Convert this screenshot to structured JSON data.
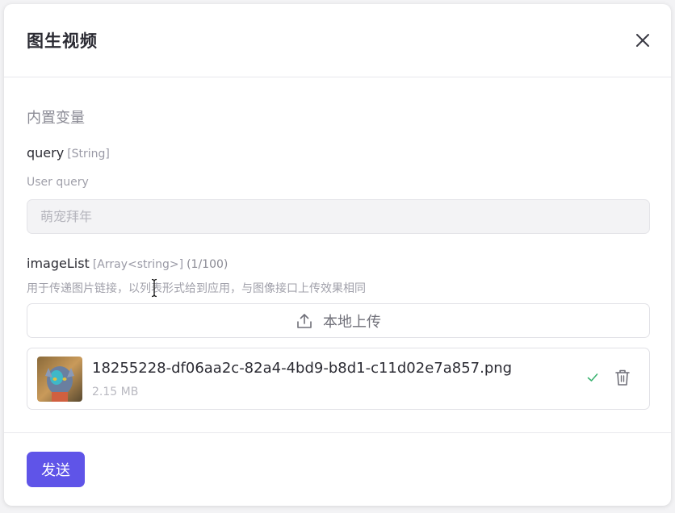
{
  "modal": {
    "title": "图生视频",
    "close_icon": "close-icon"
  },
  "section": {
    "label": "内置变量"
  },
  "query_var": {
    "name": "query",
    "type": "[String]",
    "description": "User query",
    "value": "萌宠拜年"
  },
  "image_list_var": {
    "name": "imageList",
    "type": "[Array<string>]",
    "count": "(1/100)",
    "description": "用于传递图片链接，以列表形式给到应用，与图像接口上传效果相同",
    "upload_label": "本地上传",
    "upload_icon": "upload-icon"
  },
  "file": {
    "name": "18255228-df06aa2c-82a4-4bd9-b8d1-c11d02e7a857.png",
    "size": "2.15 MB",
    "status_icon": "check-icon",
    "delete_icon": "trash-icon"
  },
  "footer": {
    "send_label": "发送"
  },
  "colors": {
    "accent": "#5f54e8",
    "success": "#3cb371"
  }
}
